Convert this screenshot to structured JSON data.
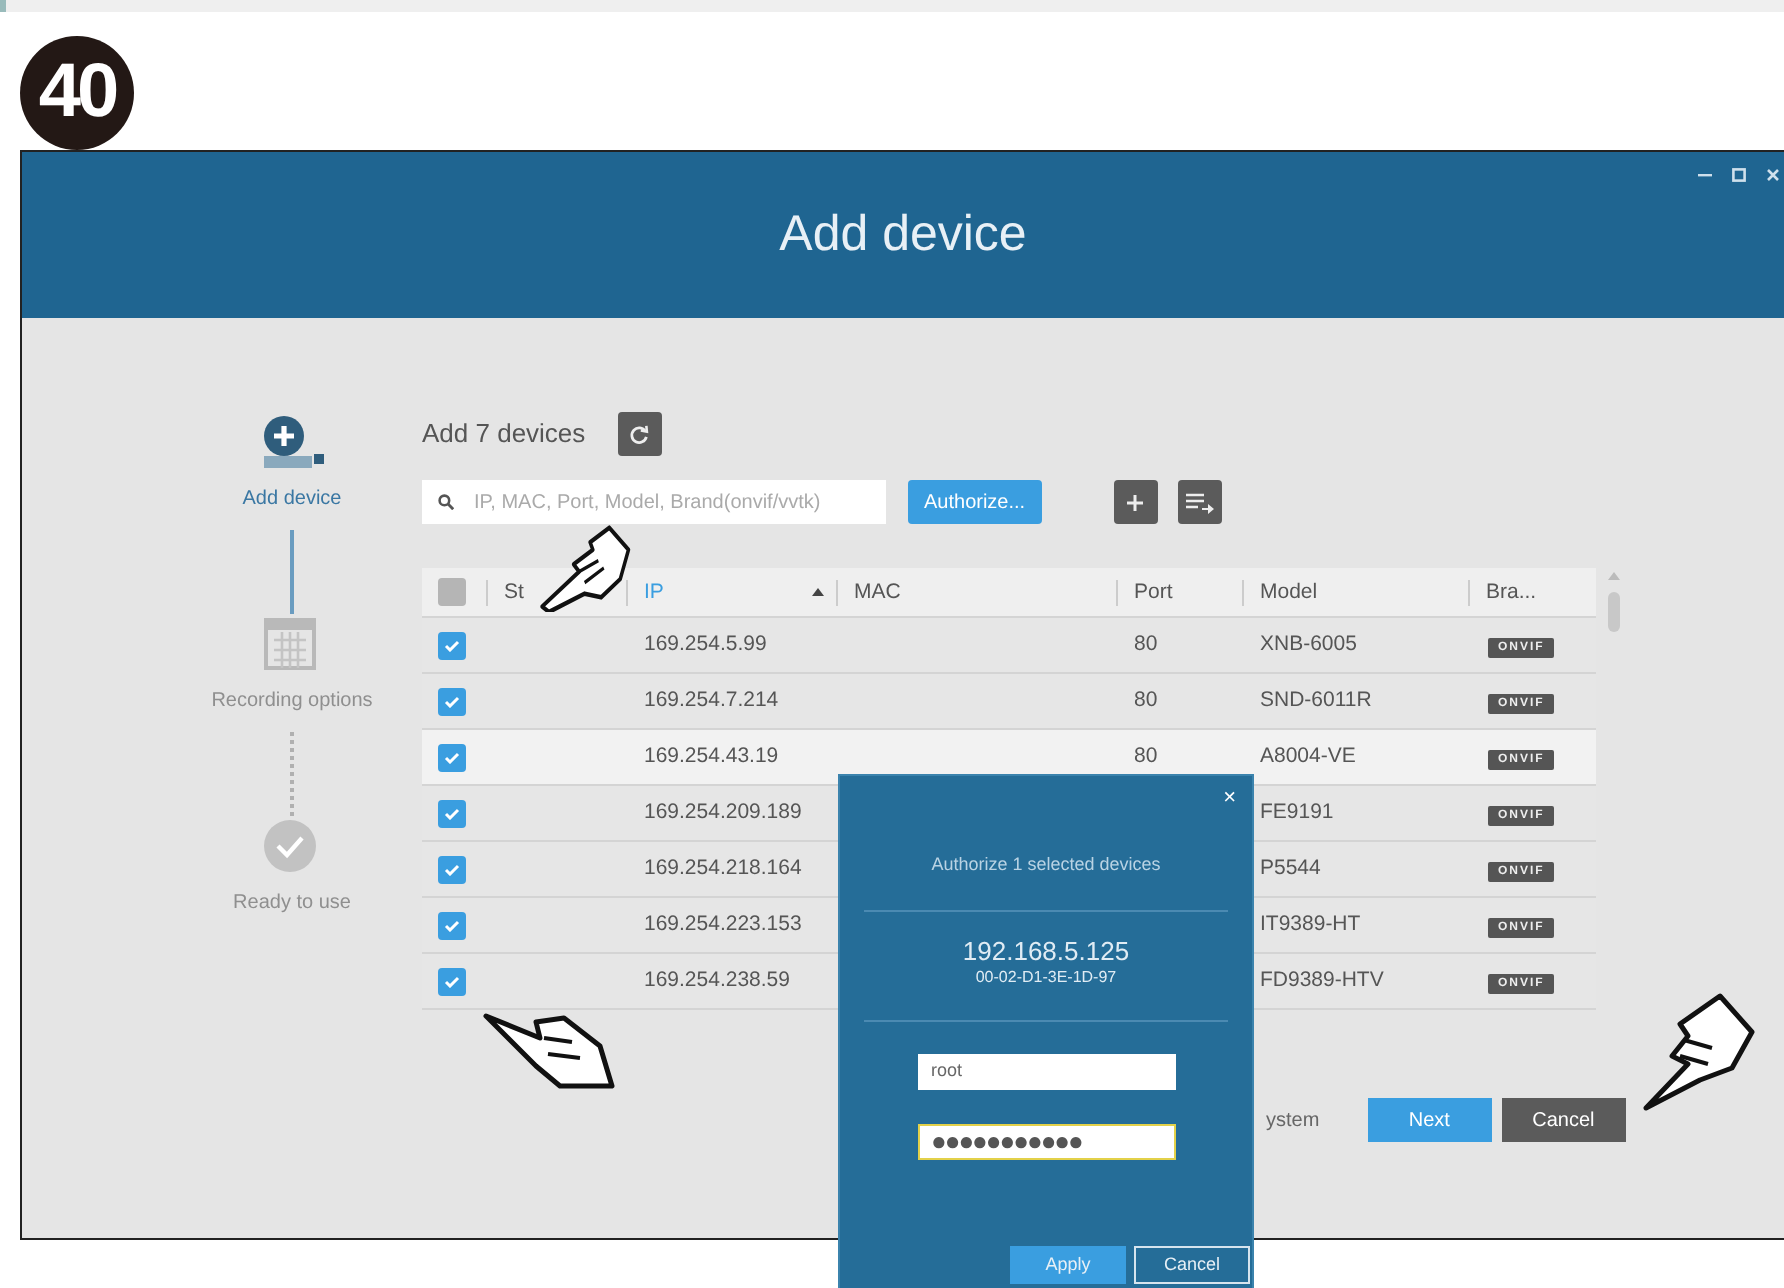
{
  "step_number": "40",
  "window": {
    "title": "Add device"
  },
  "steps": [
    {
      "label": "Add device",
      "kind": "add",
      "selected": true
    },
    {
      "label": "Recording options",
      "kind": "calendar",
      "selected": false
    },
    {
      "label": "Ready to use",
      "kind": "check",
      "selected": false
    }
  ],
  "heading": "Add 7 devices",
  "search": {
    "placeholder": "IP, MAC, Port, Model, Brand(onvif/vvtk)"
  },
  "authorize_button": "Authorize...",
  "table": {
    "select_all_checked": false,
    "columns": [
      {
        "label": "St",
        "sorted": false
      },
      {
        "label": "IP",
        "sorted": true
      },
      {
        "label": "MAC",
        "sorted": false
      },
      {
        "label": "Port",
        "sorted": false
      },
      {
        "label": "Model",
        "sorted": false
      },
      {
        "label": "Bra...",
        "sorted": false
      }
    ],
    "rows": [
      {
        "checked": true,
        "highlighted": false,
        "ip": "169.254.5.99",
        "port": "80",
        "model": "XNB-6005",
        "brand": "ONVIF"
      },
      {
        "checked": true,
        "highlighted": false,
        "ip": "169.254.7.214",
        "port": "80",
        "model": "SND-6011R",
        "brand": "ONVIF"
      },
      {
        "checked": true,
        "highlighted": true,
        "ip": "169.254.43.19",
        "port": "80",
        "model": "A8004-VE",
        "brand": "ONVIF"
      },
      {
        "checked": true,
        "highlighted": false,
        "ip": "169.254.209.189",
        "model": "FE9191",
        "brand": "ONVIF"
      },
      {
        "checked": true,
        "highlighted": false,
        "ip": "169.254.218.164",
        "model": "P5544",
        "brand": "ONVIF"
      },
      {
        "checked": true,
        "highlighted": false,
        "ip": "169.254.223.153",
        "model": "IT9389-HT",
        "brand": "ONVIF"
      },
      {
        "checked": true,
        "highlighted": false,
        "ip": "169.254.238.59",
        "model": "FD9389-HTV",
        "brand": "ONVIF"
      }
    ]
  },
  "footer": {
    "text": "ystem",
    "buttons": [
      {
        "label": "Next",
        "kind": "primary"
      },
      {
        "label": "Cancel",
        "kind": "secondary"
      }
    ]
  },
  "dialog": {
    "close": "×",
    "title": "Authorize 1 selected devices",
    "ip": "192.168.5.125",
    "mac": "00-02-D1-3E-1D-97",
    "fields": [
      {
        "value": "root",
        "focused": false
      },
      {
        "value": "●●●●●●●●●●●",
        "focused": true
      }
    ],
    "buttons": [
      {
        "label": "Apply",
        "kind": "primary"
      },
      {
        "label": "Cancel",
        "kind": "outline"
      }
    ]
  }
}
